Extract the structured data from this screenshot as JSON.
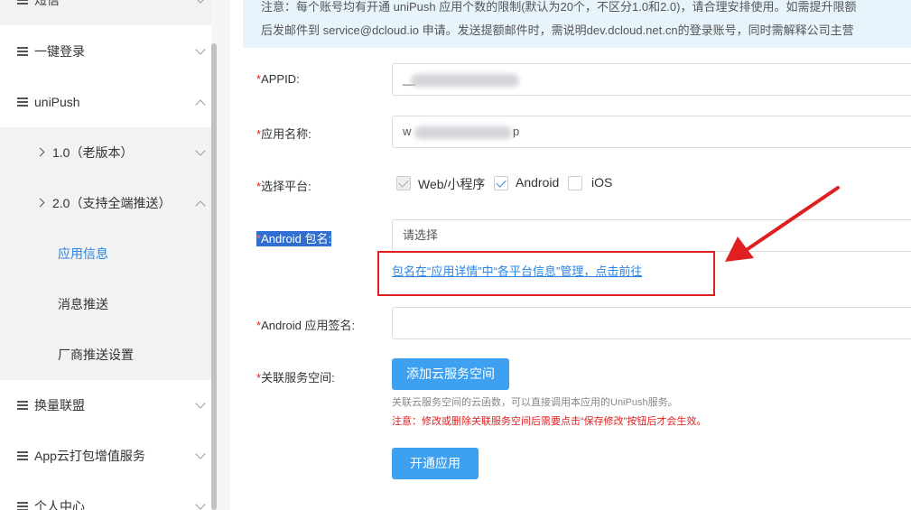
{
  "sidebar": {
    "top_item": "短信",
    "one_click_login": "一键登录",
    "unipush": "uniPush",
    "v1": "1.0（老版本）",
    "v2": "2.0（支持全端推送）",
    "app_info": "应用信息",
    "message_push": "消息推送",
    "vendor_push": "厂商推送设置",
    "exchange": "换量联盟",
    "cloud_pack": "App云打包增值服务",
    "personal": "个人中心"
  },
  "notice": {
    "line1": "注意：每个账号均有开通 uniPush 应用个数的限制(默认为20个，不区分1.0和2.0)，请合理安排使用。如需提升限额",
    "line2": "后发邮件到 service@dcloud.io 申请。发送提额邮件时，需说明dev.dcloud.net.cn的登录账号，同时需解释公司主营"
  },
  "form": {
    "required_mark": "*",
    "appid_label": "APPID:",
    "appid_value": "__",
    "app_name_label": "应用名称:",
    "app_name_prefix": "w",
    "app_name_suffix": "p",
    "platform_label": "选择平台:",
    "platforms": [
      "Web/小程序",
      "Android",
      "iOS"
    ],
    "android_pkg_label": "Android 包名:",
    "android_pkg_placeholder": "请选择",
    "pkg_link": "包名在“应用详情”中“各平台信息”管理，点击前往",
    "android_sig_label": "Android 应用签名:",
    "service_space_label": "关联服务空间:",
    "add_space_button": "添加云服务空间",
    "hint_gray": "关联云服务空间的云函数，可以直接调用本应用的UniPush服务。",
    "hint_red": "注意：修改或删除关联服务空间后需要点击“保存修改”按钮后才会生效。",
    "open_button": "开通应用"
  },
  "colors": {
    "accent": "#2b85e4",
    "button": "#3ea0f0",
    "annotation_red": "#e02020"
  }
}
